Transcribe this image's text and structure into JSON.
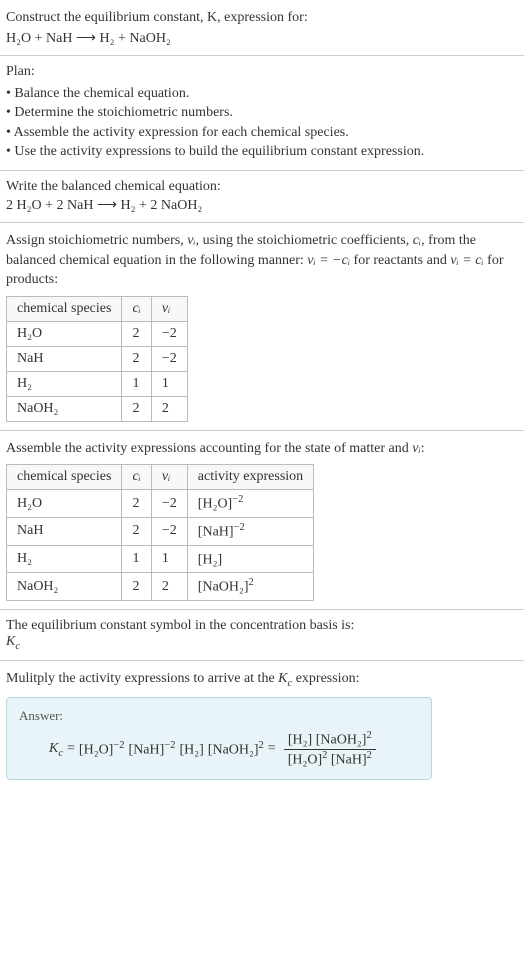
{
  "intro": {
    "prompt": "Construct the equilibrium constant, K, expression for:",
    "equation": "H₂O + NaH ⟶ H₂ + NaOH₂"
  },
  "plan": {
    "title": "Plan:",
    "items": [
      "Balance the chemical equation.",
      "Determine the stoichiometric numbers.",
      "Assemble the activity expression for each chemical species.",
      "Use the activity expressions to build the equilibrium constant expression."
    ]
  },
  "balanced": {
    "title": "Write the balanced chemical equation:",
    "equation": "2 H₂O + 2 NaH ⟶ H₂ + 2 NaOH₂"
  },
  "stoich": {
    "intro_a": "Assign stoichiometric numbers, ",
    "nu_i": "νᵢ",
    "intro_b": ", using the stoichiometric coefficients, ",
    "c_i": "cᵢ",
    "intro_c": ", from the balanced chemical equation in the following manner: ",
    "rel1": "νᵢ = −cᵢ",
    "intro_d": " for reactants and ",
    "rel2": "νᵢ = cᵢ",
    "intro_e": " for products:",
    "headers": {
      "species": "chemical species",
      "ci": "cᵢ",
      "nui": "νᵢ"
    },
    "rows": [
      {
        "species": "H₂O",
        "ci": "2",
        "nui": "−2"
      },
      {
        "species": "NaH",
        "ci": "2",
        "nui": "−2"
      },
      {
        "species": "H₂",
        "ci": "1",
        "nui": "1"
      },
      {
        "species": "NaOH₂",
        "ci": "2",
        "nui": "2"
      }
    ]
  },
  "activity": {
    "intro_a": "Assemble the activity expressions accounting for the state of matter and ",
    "nu_i": "νᵢ",
    "intro_b": ":",
    "headers": {
      "species": "chemical species",
      "ci": "cᵢ",
      "nui": "νᵢ",
      "act": "activity expression"
    },
    "rows": [
      {
        "species": "H₂O",
        "ci": "2",
        "nui": "−2",
        "act_base": "[H₂O]",
        "act_exp": "−2"
      },
      {
        "species": "NaH",
        "ci": "2",
        "nui": "−2",
        "act_base": "[NaH]",
        "act_exp": "−2"
      },
      {
        "species": "H₂",
        "ci": "1",
        "nui": "1",
        "act_base": "[H₂]",
        "act_exp": ""
      },
      {
        "species": "NaOH₂",
        "ci": "2",
        "nui": "2",
        "act_base": "[NaOH₂]",
        "act_exp": "2"
      }
    ]
  },
  "symbol": {
    "line1": "The equilibrium constant symbol in the concentration basis is:",
    "line2_base": "K",
    "line2_sub": "c"
  },
  "multiply": {
    "intro_a": "Mulitply the activity expressions to arrive at the ",
    "kc_base": "K",
    "kc_sub": "c",
    "intro_b": " expression:"
  },
  "answer": {
    "label": "Answer:",
    "lhs_base": "K",
    "lhs_sub": "c",
    "eq": " = ",
    "t1_base": "[H₂O]",
    "t1_exp": "−2",
    "t2_base": "[NaH]",
    "t2_exp": "−2",
    "t3_base": "[H₂]",
    "t3_exp": "",
    "t4_base": "[NaOH₂]",
    "t4_exp": "2",
    "eq2": " = ",
    "num_a_base": "[H₂]",
    "num_a_exp": "",
    "num_b_base": "[NaOH₂]",
    "num_b_exp": "2",
    "den_a_base": "[H₂O]",
    "den_a_exp": "2",
    "den_b_base": "[NaH]",
    "den_b_exp": "2"
  },
  "chart_data": {
    "type": "table",
    "tables": [
      {
        "title": "Stoichiometric numbers",
        "columns": [
          "chemical species",
          "cᵢ",
          "νᵢ"
        ],
        "rows": [
          [
            "H₂O",
            2,
            -2
          ],
          [
            "NaH",
            2,
            -2
          ],
          [
            "H₂",
            1,
            1
          ],
          [
            "NaOH₂",
            2,
            2
          ]
        ]
      },
      {
        "title": "Activity expressions",
        "columns": [
          "chemical species",
          "cᵢ",
          "νᵢ",
          "activity expression"
        ],
        "rows": [
          [
            "H₂O",
            2,
            -2,
            "[H₂O]^−2"
          ],
          [
            "NaH",
            2,
            -2,
            "[NaH]^−2"
          ],
          [
            "H₂",
            1,
            1,
            "[H₂]"
          ],
          [
            "NaOH₂",
            2,
            2,
            "[NaOH₂]^2"
          ]
        ]
      }
    ]
  }
}
